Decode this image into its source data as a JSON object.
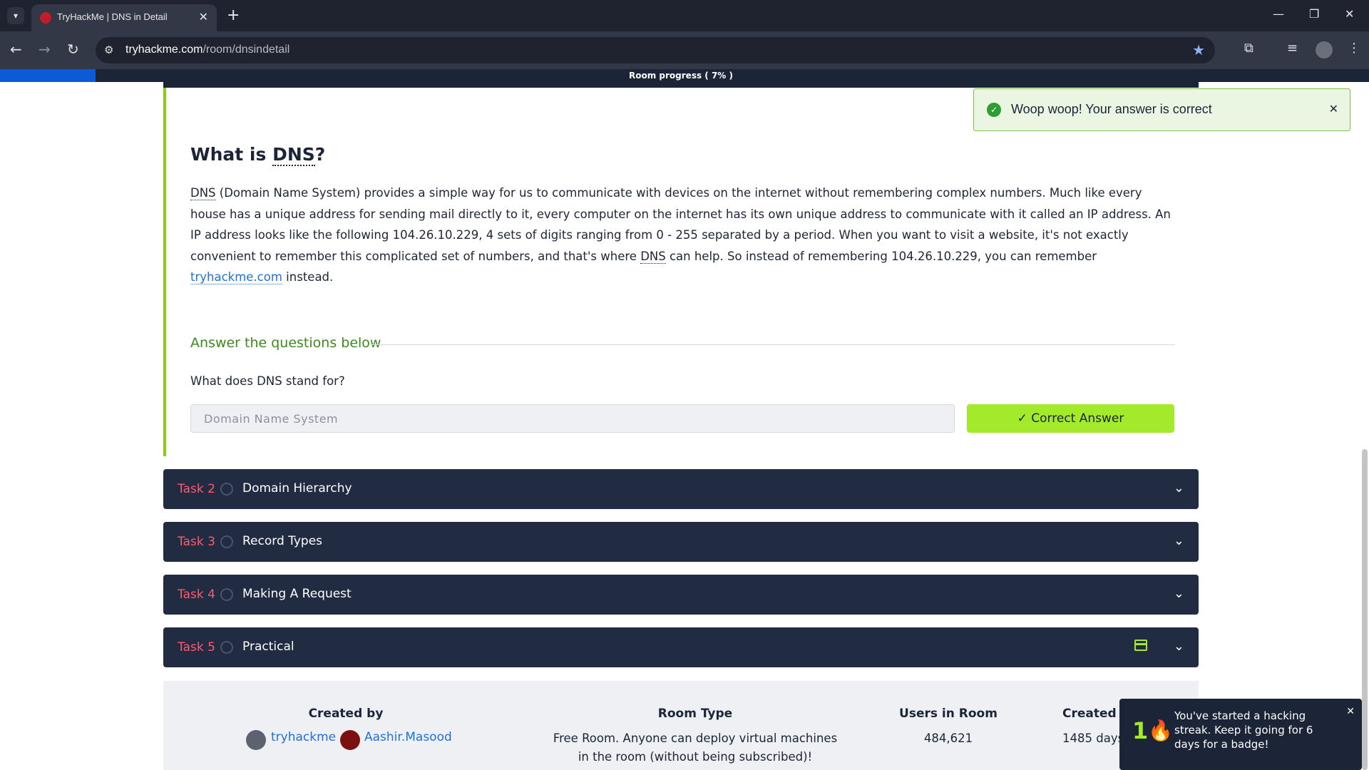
{
  "browser": {
    "tab_title": "TryHackMe | DNS in Detail",
    "url_host": "tryhackme.com",
    "url_path": "/room/dnsindetail"
  },
  "progress": {
    "label": "Room progress ( 7% )",
    "value": 0.07
  },
  "task1": {
    "heading_prefix": "What is ",
    "heading_abbr": "DNS",
    "heading_suffix": "?",
    "body": {
      "abbr1": "DNS",
      "p1": " (Domain Name System) provides a simple way for us to communicate with devices on the internet without remembering complex numbers. Much like every house has a unique address for sending mail directly to it, every computer on the internet has its own unique address to communicate with it called an IP address. An IP address looks like the following 104.26.10.229, 4 sets of digits ranging from 0 - 255 separated by a period. When you want to visit a website, it's not exactly convenient to remember this complicated set of numbers, and that's where ",
      "abbr2": "DNS",
      "p2": " can help. So instead of remembering 104.26.10.229, you can remember ",
      "link": "tryhackme.com",
      "p3": " instead."
    },
    "answer_title": "Answer the questions below",
    "question": "What does DNS stand for?",
    "answer_value": "Domain Name System",
    "correct_button": "Correct Answer"
  },
  "tasks": [
    {
      "num": "Task 2",
      "title": "Domain Hierarchy"
    },
    {
      "num": "Task 3",
      "title": "Record Types"
    },
    {
      "num": "Task 4",
      "title": "Making A Request"
    },
    {
      "num": "Task 5",
      "title": "Practical"
    }
  ],
  "info": {
    "created_by_label": "Created by",
    "creators": [
      "tryhackme",
      "Aashir.Masood"
    ],
    "room_type_label": "Room Type",
    "room_type_value_1": "Free Room. Anyone can deploy virtual machines",
    "room_type_value_2": "in the room (without being subscribed)!",
    "users_label": "Users in Room",
    "users_value": "484,621",
    "created_label": "Created",
    "created_value": "1485 days"
  },
  "toast_success": {
    "message": "Woop woop! Your answer is correct"
  },
  "toast_streak": {
    "count": "1",
    "message": "You've started a hacking streak. Keep it going for 6 days for a badge!"
  },
  "colors": {
    "accent_green": "#a3ea2a",
    "task_red": "#ff5a6a",
    "navy": "#212c42",
    "link_blue": "#1d72d8"
  }
}
